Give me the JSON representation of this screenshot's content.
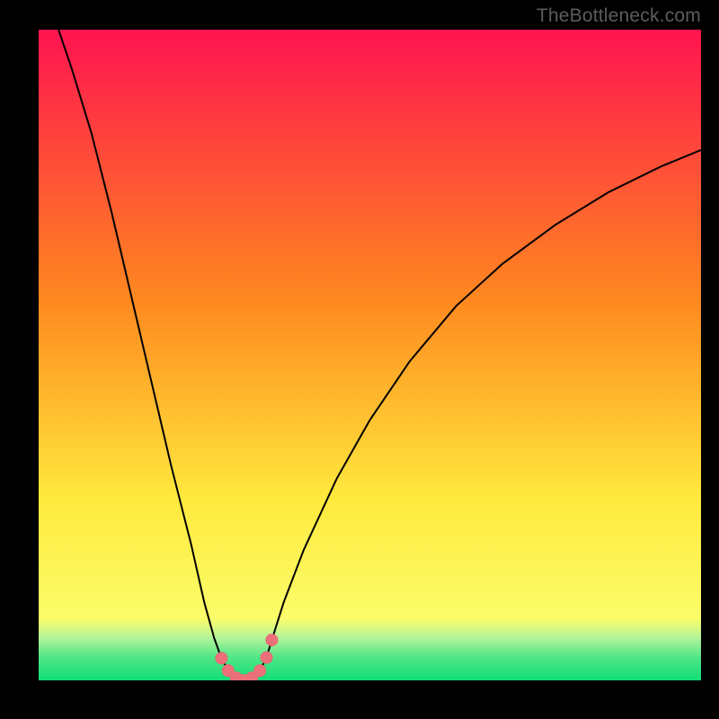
{
  "watermark": "TheBottleneck.com",
  "colors": {
    "black": "#000000",
    "curve": "#000000",
    "marker_fill": "#ec7079",
    "marker_stroke": "#e86a73",
    "grad_top": "#ff1450",
    "grad_mid1": "#ff8a1f",
    "grad_mid2": "#ffe93d",
    "grad_low": "#fbfd6a",
    "grad_green_top": "#b2f49a",
    "grad_green_mid": "#4fe686",
    "grad_green_bot": "#12dd77"
  },
  "chart_data": {
    "type": "line",
    "title": "",
    "xlabel": "",
    "ylabel": "",
    "xlim": [
      0,
      100
    ],
    "ylim": [
      0,
      100
    ],
    "curve": [
      {
        "x": 3.0,
        "y": 100.0
      },
      {
        "x": 5.0,
        "y": 94.0
      },
      {
        "x": 8.0,
        "y": 84.0
      },
      {
        "x": 11.0,
        "y": 72.0
      },
      {
        "x": 14.0,
        "y": 59.0
      },
      {
        "x": 17.0,
        "y": 46.0
      },
      {
        "x": 20.0,
        "y": 33.0
      },
      {
        "x": 23.0,
        "y": 21.0
      },
      {
        "x": 25.0,
        "y": 12.0
      },
      {
        "x": 26.5,
        "y": 6.5
      },
      {
        "x": 27.6,
        "y": 3.4
      },
      {
        "x": 28.6,
        "y": 1.5
      },
      {
        "x": 29.8,
        "y": 0.4
      },
      {
        "x": 31.0,
        "y": 0.0
      },
      {
        "x": 32.2,
        "y": 0.4
      },
      {
        "x": 33.4,
        "y": 1.5
      },
      {
        "x": 34.4,
        "y": 3.5
      },
      {
        "x": 35.2,
        "y": 6.2
      },
      {
        "x": 37.0,
        "y": 12.0
      },
      {
        "x": 40.0,
        "y": 20.0
      },
      {
        "x": 45.0,
        "y": 31.0
      },
      {
        "x": 50.0,
        "y": 40.0
      },
      {
        "x": 56.0,
        "y": 49.0
      },
      {
        "x": 63.0,
        "y": 57.5
      },
      {
        "x": 70.0,
        "y": 64.0
      },
      {
        "x": 78.0,
        "y": 70.0
      },
      {
        "x": 86.0,
        "y": 75.0
      },
      {
        "x": 94.0,
        "y": 79.0
      },
      {
        "x": 100.0,
        "y": 81.5
      }
    ],
    "markers": [
      {
        "x": 27.6,
        "y": 3.4
      },
      {
        "x": 28.6,
        "y": 1.5
      },
      {
        "x": 29.8,
        "y": 0.4
      },
      {
        "x": 31.0,
        "y": 0.0
      },
      {
        "x": 32.2,
        "y": 0.4
      },
      {
        "x": 33.4,
        "y": 1.5
      },
      {
        "x": 34.4,
        "y": 3.5
      },
      {
        "x": 35.2,
        "y": 6.2
      }
    ],
    "gradient_stops": [
      {
        "offset": 0.0,
        "key": "grad_top"
      },
      {
        "offset": 0.42,
        "key": "grad_mid1"
      },
      {
        "offset": 0.72,
        "key": "grad_mid2"
      },
      {
        "offset": 0.905,
        "key": "grad_low"
      },
      {
        "offset": 0.935,
        "key": "grad_green_top"
      },
      {
        "offset": 0.965,
        "key": "grad_green_mid"
      },
      {
        "offset": 1.0,
        "key": "grad_green_bot"
      }
    ]
  }
}
